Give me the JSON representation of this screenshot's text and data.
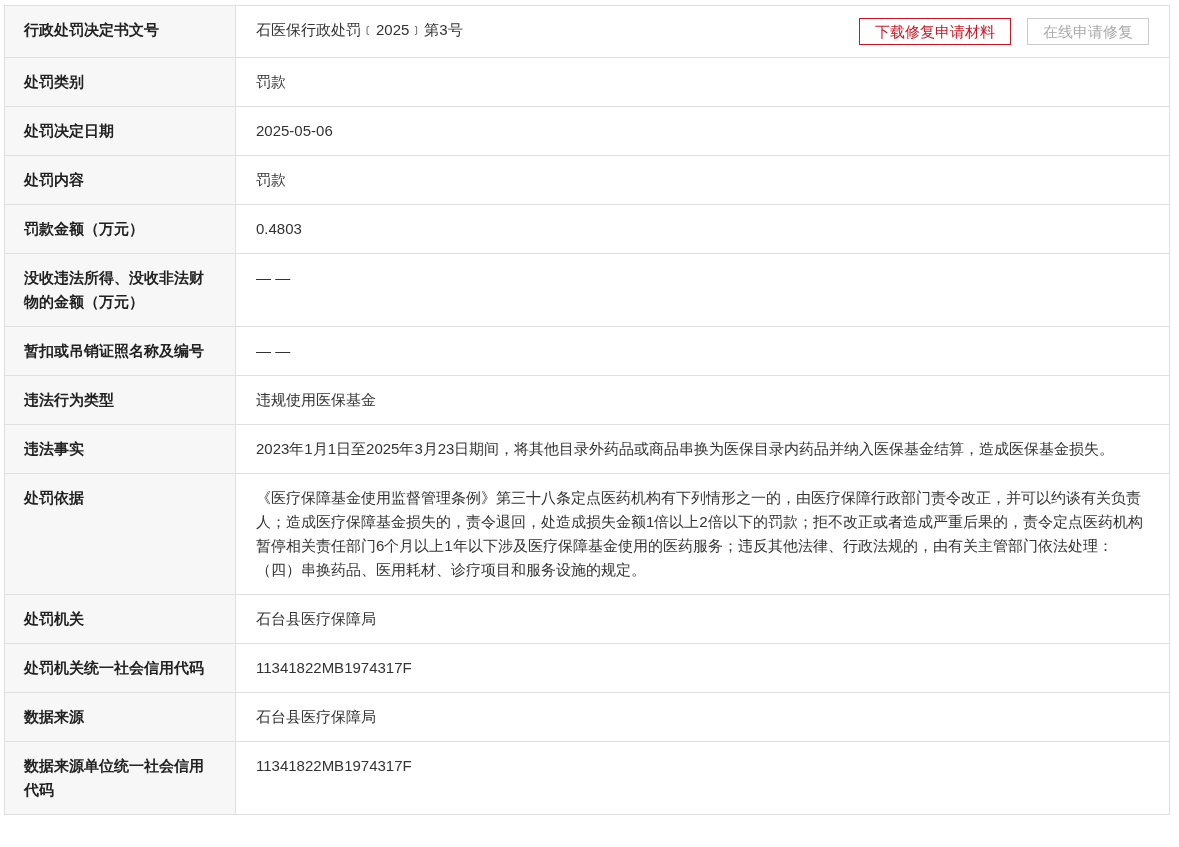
{
  "rows": [
    {
      "label": "行政处罚决定书文号",
      "value": "石医保行政处罚﹝2025﹞第3号",
      "buttons": [
        {
          "label": "下载修复申请材料",
          "disabled": false
        },
        {
          "label": "在线申请修复",
          "disabled": true
        }
      ]
    },
    {
      "label": "处罚类别",
      "value": "罚款"
    },
    {
      "label": "处罚决定日期",
      "value": "2025-05-06"
    },
    {
      "label": "处罚内容",
      "value": "罚款"
    },
    {
      "label": "罚款金额（万元）",
      "value": "0.4803"
    },
    {
      "label": "没收违法所得、没收非法财物的金额（万元）",
      "value": "— —"
    },
    {
      "label": "暂扣或吊销证照名称及编号",
      "value": "— —"
    },
    {
      "label": "违法行为类型",
      "value": "违规使用医保基金"
    },
    {
      "label": "违法事实",
      "value": "2023年1月1日至2025年3月23日期间，将其他目录外药品或商品串换为医保目录内药品并纳入医保基金结算，造成医保基金损失。"
    },
    {
      "label": "处罚依据",
      "value": "《医疗保障基金使用监督管理条例》第三十八条定点医药机构有下列情形之一的，由医疗保障行政部门责令改正，并可以约谈有关负责人；造成医疗保障基金损失的，责令退回，处造成损失金额1倍以上2倍以下的罚款；拒不改正或者造成严重后果的，责令定点医药机构暂停相关责任部门6个月以上1年以下涉及医疗保障基金使用的医药服务；违反其他法律、行政法规的，由有关主管部门依法处理：（四）串换药品、医用耗材、诊疗项目和服务设施的规定。"
    },
    {
      "label": "处罚机关",
      "value": "石台县医疗保障局"
    },
    {
      "label": "处罚机关统一社会信用代码",
      "value": "11341822MB1974317F"
    },
    {
      "label": "数据来源",
      "value": "石台县医疗保障局"
    },
    {
      "label": "数据来源单位统一社会信用代码",
      "value": "11341822MB1974317F"
    }
  ]
}
